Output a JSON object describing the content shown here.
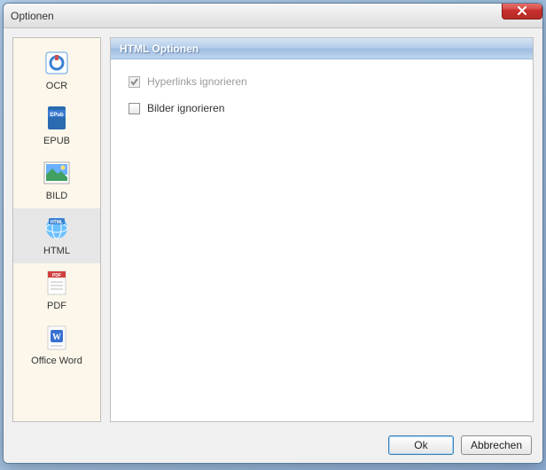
{
  "window": {
    "title": "Optionen"
  },
  "sidebar": {
    "items": [
      {
        "label": "OCR"
      },
      {
        "label": "EPUB"
      },
      {
        "label": "BILD"
      },
      {
        "label": "HTML"
      },
      {
        "label": "PDF"
      },
      {
        "label": "Office Word"
      }
    ],
    "selected_index": 3
  },
  "panel": {
    "header": "HTML Optionen",
    "options": [
      {
        "label": "Hyperlinks ignorieren",
        "checked": true,
        "enabled": false
      },
      {
        "label": "Bilder ignorieren",
        "checked": false,
        "enabled": true
      }
    ]
  },
  "footer": {
    "ok": "Ok",
    "cancel": "Abbrechen"
  }
}
